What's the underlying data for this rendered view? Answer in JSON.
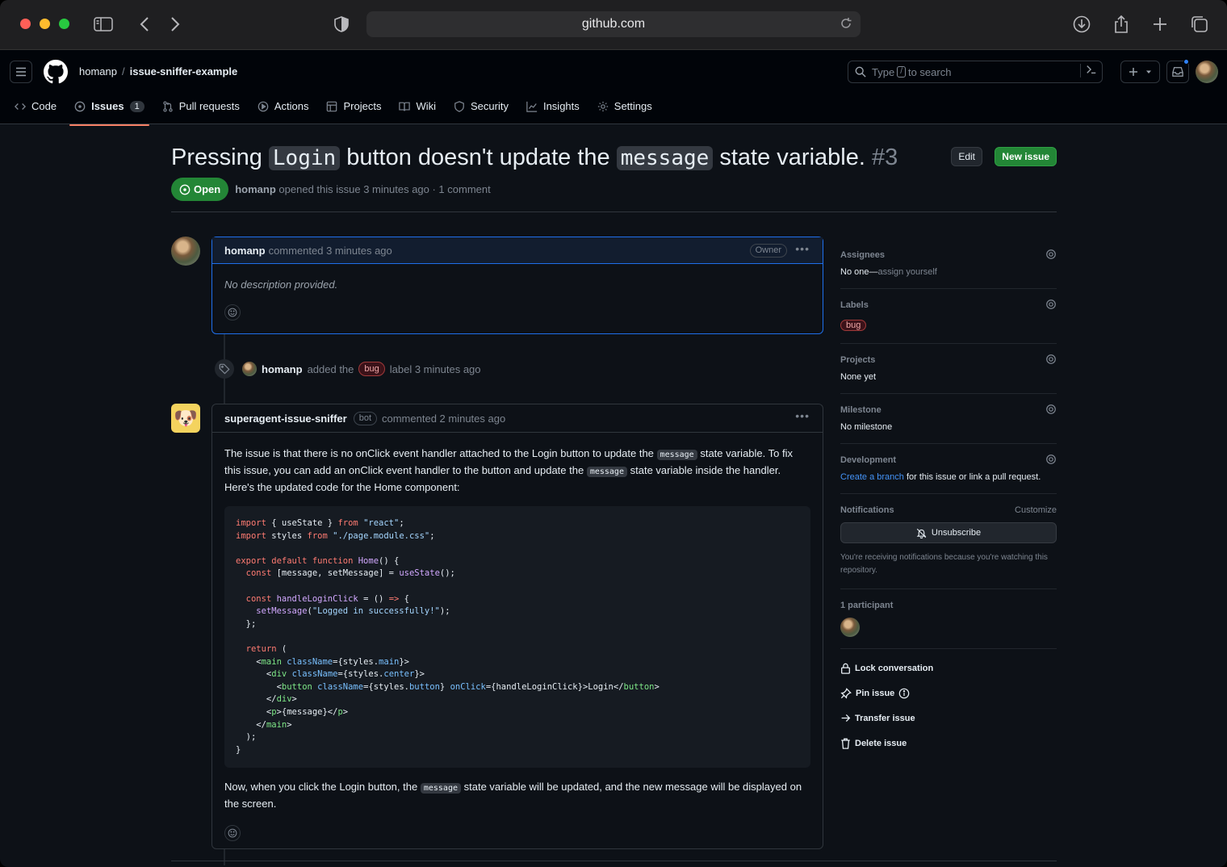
{
  "browser": {
    "url": "github.com"
  },
  "header": {
    "owner": "homanp",
    "separator": "/",
    "repo": "issue-sniffer-example",
    "search_prefix": "Type",
    "search_key": "/",
    "search_suffix": "to search"
  },
  "nav": [
    {
      "label": "Code",
      "icon": "code-icon"
    },
    {
      "label": "Issues",
      "icon": "issue-icon",
      "count": "1",
      "active": true
    },
    {
      "label": "Pull requests",
      "icon": "pull-request-icon"
    },
    {
      "label": "Actions",
      "icon": "play-icon"
    },
    {
      "label": "Projects",
      "icon": "table-icon"
    },
    {
      "label": "Wiki",
      "icon": "book-icon"
    },
    {
      "label": "Security",
      "icon": "shield-icon"
    },
    {
      "label": "Insights",
      "icon": "graph-icon"
    },
    {
      "label": "Settings",
      "icon": "gear-icon"
    }
  ],
  "issue": {
    "title_1": "Pressing",
    "title_code_1": "Login",
    "title_2": "button doesn't update the",
    "title_code_2": "message",
    "title_3": "state variable.",
    "number": "#3",
    "edit_label": "Edit",
    "new_label": "New issue",
    "state": "Open",
    "author": "homanp",
    "meta": "opened this issue 3 minutes ago · 1 comment"
  },
  "comment1": {
    "author": "homanp",
    "time": "commented 3 minutes ago",
    "role": "Owner",
    "body": "No description provided."
  },
  "event": {
    "actor": "homanp",
    "text_before": "added the",
    "label": "bug",
    "text_after": "label 3 minutes ago"
  },
  "comment2": {
    "author": "superagent-issue-sniffer",
    "bot": "bot",
    "time": "commented 2 minutes ago",
    "p1_a": "The issue is that there is no onClick event handler attached to the Login button to update the",
    "p1_code": "message",
    "p1_b": "state variable. To fix this issue, you can add an onClick event handler to the button and update the",
    "p1_code2": "message",
    "p1_c": "state variable inside the handler. Here's the updated code for the Home component:",
    "p2_a": "Now, when you click the Login button, the",
    "p2_code": "message",
    "p2_b": "state variable will be updated, and the new message will be displayed on the screen."
  },
  "sidebar": {
    "assignees_title": "Assignees",
    "assignees_value": "No one—",
    "assignees_link": "assign yourself",
    "labels_title": "Labels",
    "labels_value": "bug",
    "projects_title": "Projects",
    "projects_value": "None yet",
    "milestone_title": "Milestone",
    "milestone_value": "No milestone",
    "development_title": "Development",
    "development_link": "Create a branch",
    "development_rest": "for this issue or link a pull request.",
    "notifications_title": "Notifications",
    "customize": "Customize",
    "unsubscribe": "Unsubscribe",
    "notify_note": "You're receiving notifications because you're watching this repository.",
    "participants": "1 participant",
    "lock": "Lock conversation",
    "pin": "Pin issue",
    "transfer": "Transfer issue",
    "delete": "Delete issue"
  },
  "colors": {
    "accent": "#f78166",
    "open": "#238636",
    "link": "#4493f8"
  }
}
